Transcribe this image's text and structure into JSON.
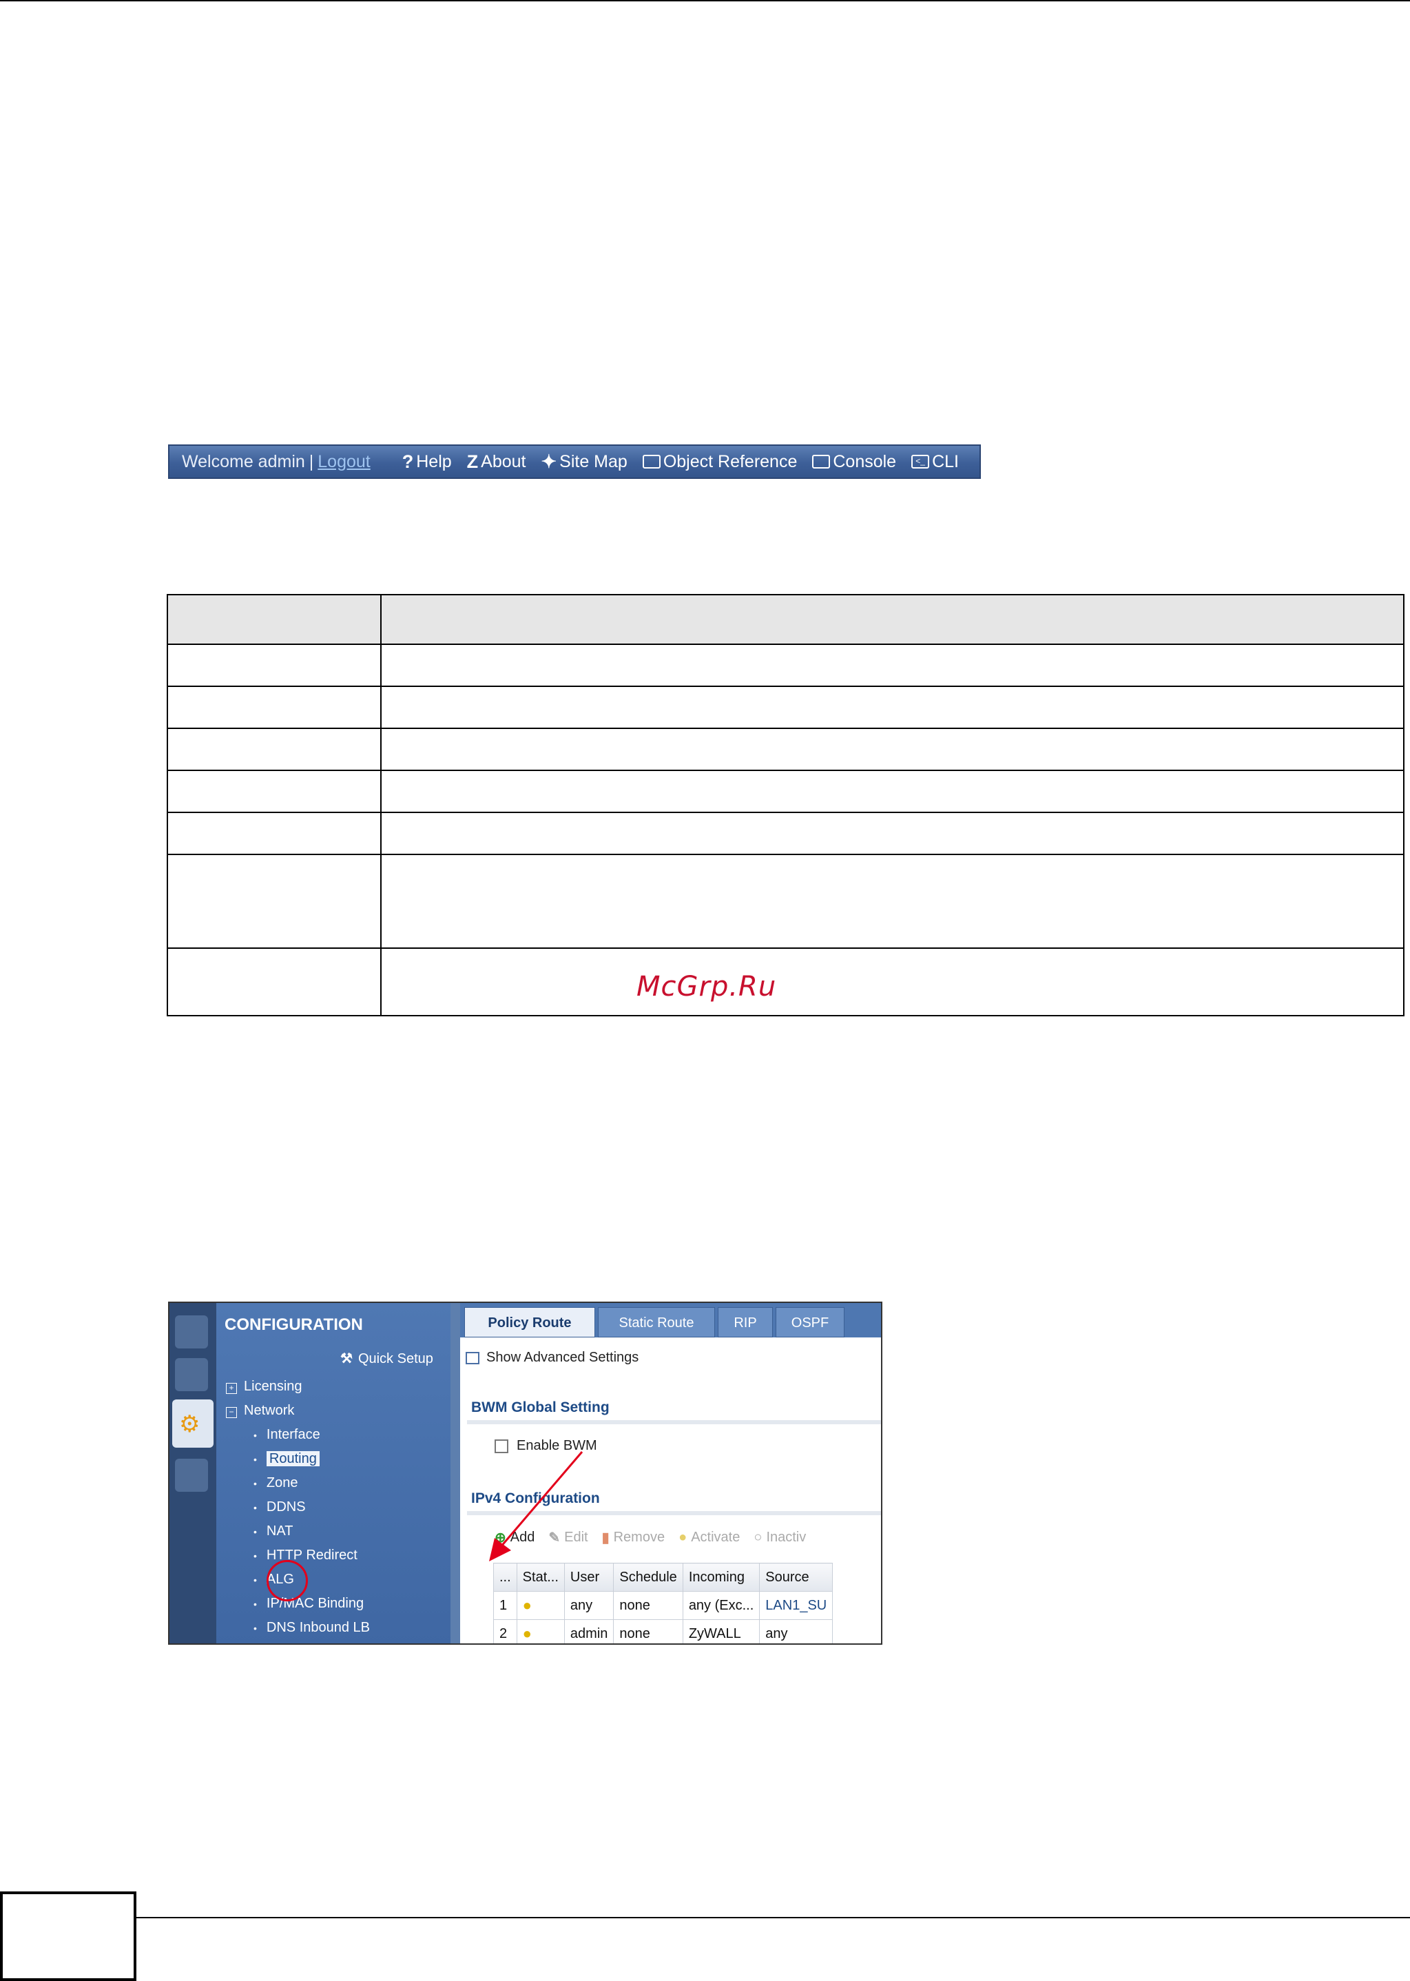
{
  "titlebar": {
    "welcome": "Welcome admin",
    "separator": "|",
    "logout": "Logout",
    "items": [
      {
        "icon": "help-icon",
        "glyph": "?",
        "label": "Help"
      },
      {
        "icon": "about-icon",
        "glyph": "Z",
        "label": "About"
      },
      {
        "icon": "site-map-icon",
        "glyph": "✦",
        "label": "Site Map"
      },
      {
        "icon": "object-reference-icon",
        "glyph": "",
        "label": "Object Reference"
      },
      {
        "icon": "console-icon",
        "glyph": "",
        "label": "Console"
      },
      {
        "icon": "cli-icon",
        "glyph": "<_",
        "label": "CLI"
      }
    ]
  },
  "watermark": "McGrp.Ru",
  "config": {
    "title": "CONFIGURATION",
    "quick_setup": "Quick Setup",
    "groups": [
      {
        "sign": "+",
        "label": "Licensing"
      },
      {
        "sign": "−",
        "label": "Network"
      }
    ],
    "nav_items": [
      "Interface",
      "Routing",
      "Zone",
      "DDNS",
      "NAT",
      "HTTP Redirect",
      "ALG",
      "IP/MAC Binding",
      "DNS Inbound LB"
    ],
    "selected_item": "Routing",
    "tabs": [
      "Policy Route",
      "Static Route",
      "RIP",
      "OSPF"
    ],
    "active_tab": "Policy Route",
    "show_advanced": "Show Advanced Settings",
    "bwm_section": "BWM Global Setting",
    "enable_bwm": "Enable BWM",
    "ipv4_section": "IPv4 Configuration",
    "toolbar": [
      "Add",
      "Edit",
      "Remove",
      "Activate",
      "Inactiv"
    ],
    "columns": [
      "...",
      "Stat...",
      "User",
      "Schedule",
      "Incoming",
      "Source"
    ],
    "rows": [
      {
        "num": "1",
        "user": "any",
        "schedule": "none",
        "incoming": "any (Exc...",
        "source": "LAN1_SU"
      },
      {
        "num": "2",
        "user": "admin",
        "schedule": "none",
        "incoming": "ZyWALL",
        "source": "any"
      }
    ]
  },
  "colors": {
    "accent": "#3d5f98",
    "annotation": "#e3001b"
  }
}
